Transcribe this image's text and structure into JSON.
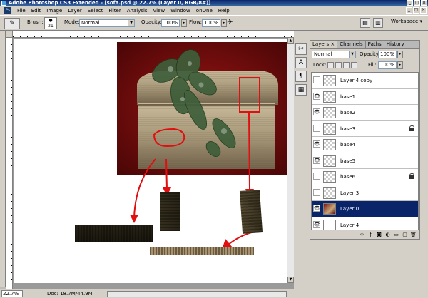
{
  "window": {
    "title": "Adobe Photoshop CS3 Extended - [sofa.psd @ 22.7% (Layer 0, RGB/8#)]",
    "controls": [
      "_",
      "□",
      "×"
    ]
  },
  "menu": {
    "items": [
      "File",
      "Edit",
      "Image",
      "Layer",
      "Select",
      "Filter",
      "Analysis",
      "View",
      "Window",
      "onOne",
      "Help"
    ]
  },
  "options_bar": {
    "brush_label": "Brush:",
    "brush_size": "21",
    "mode_label": "Mode:",
    "mode_value": "Normal",
    "opacity_label": "Opacity:",
    "opacity_value": "100%",
    "flow_label": "Flow:",
    "flow_value": "100%",
    "workspace_label": "Workspace ▾"
  },
  "layers_panel": {
    "tabs": [
      "Layers ×",
      "Channels",
      "Paths",
      "History"
    ],
    "blend_mode": "Normal",
    "opacity_label": "Opacity:",
    "opacity_value": "100%",
    "lock_label": "Lock:",
    "fill_label": "Fill:",
    "fill_value": "100%",
    "layers": [
      {
        "name": "Layer 4 copy",
        "visible": false,
        "locked": false,
        "thumb": "transparent"
      },
      {
        "name": "base1",
        "visible": true,
        "locked": false,
        "thumb": "transparent"
      },
      {
        "name": "base2",
        "visible": true,
        "locked": false,
        "thumb": "transparent"
      },
      {
        "name": "base3",
        "visible": false,
        "locked": true,
        "thumb": "transparent"
      },
      {
        "name": "base4",
        "visible": true,
        "locked": false,
        "thumb": "transparent"
      },
      {
        "name": "base5",
        "visible": true,
        "locked": false,
        "thumb": "transparent"
      },
      {
        "name": "base6",
        "visible": false,
        "locked": true,
        "thumb": "transparent"
      },
      {
        "name": "Layer 3",
        "visible": false,
        "locked": false,
        "thumb": "transparent"
      },
      {
        "name": "Layer 0",
        "visible": true,
        "locked": false,
        "thumb": "photo",
        "selected": true
      },
      {
        "name": "Layer 4",
        "visible": true,
        "locked": false,
        "thumb": "white"
      }
    ]
  },
  "status_bar": {
    "zoom": "22.7%",
    "doc_info": "Doc: 18.7M/44.9M"
  },
  "colors": {
    "selection": "#0a246a",
    "annotation_red": "#e01010",
    "photo_background": "#8b1010"
  }
}
